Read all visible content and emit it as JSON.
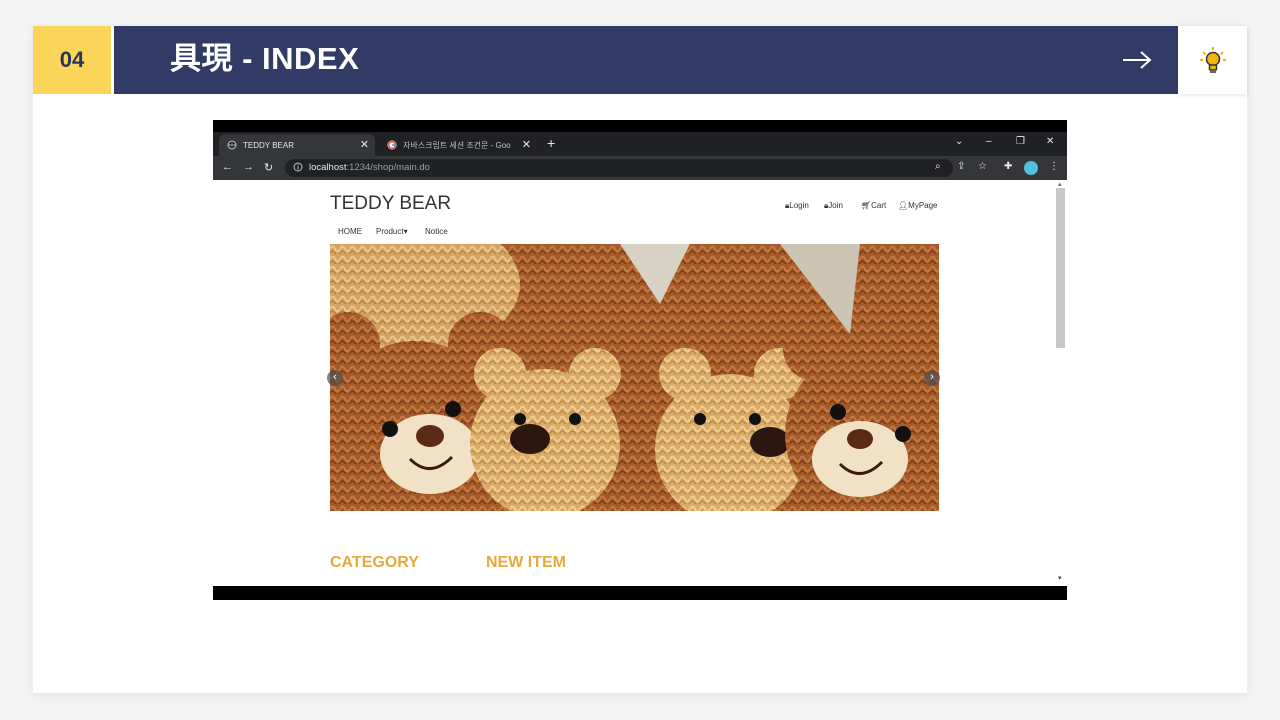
{
  "slide": {
    "number": "04",
    "title": "具現 - INDEX",
    "next_icon": "arrow-right-icon",
    "idea_icon": "lightbulb-icon",
    "accent_yellow": "#fbd45a",
    "title_bg": "#323b66"
  },
  "browser": {
    "tabs": [
      {
        "label": "TEDDY BEAR",
        "active": true
      },
      {
        "label": "자바스크립트 세션 조건문 - Goo",
        "active": false
      }
    ],
    "url_host": "localhost",
    "url_path": ":1234/shop/main.do"
  },
  "site": {
    "brand": "TEDDY BEAR",
    "top_links": [
      "Login",
      "Join",
      "Cart",
      "MyPage"
    ],
    "menu": [
      "HOME",
      "Product",
      "Notice"
    ],
    "banner_image": "teddy-bears-photo",
    "sections": [
      "CATEGORY",
      "NEW ITEM"
    ],
    "section_color": "#e8a93c"
  }
}
